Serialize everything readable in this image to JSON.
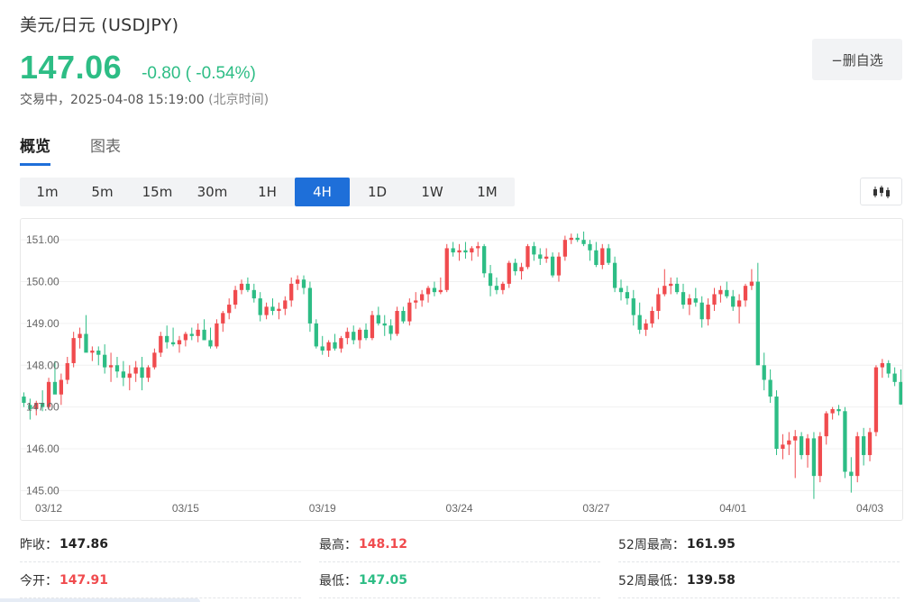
{
  "header": {
    "title": "美元/日元 (USDJPY)",
    "price": "147.06",
    "change": "-0.80 ( -0.54%)",
    "status": "交易中，2025-04-08 15:19:00",
    "timezone": "(北京时间)",
    "favorite_label": "−删自选"
  },
  "tabs": [
    {
      "label": "概览",
      "active": true
    },
    {
      "label": "图表",
      "active": false
    }
  ],
  "periods": [
    {
      "label": "1m"
    },
    {
      "label": "5m"
    },
    {
      "label": "15m"
    },
    {
      "label": "30m"
    },
    {
      "label": "1H"
    },
    {
      "label": "4H",
      "active": true
    },
    {
      "label": "1D"
    },
    {
      "label": "1W"
    },
    {
      "label": "1M"
    }
  ],
  "colors": {
    "up": "#f04b4e",
    "down": "#2dbd85",
    "accent": "#1e6fd9",
    "grid": "#f0f0f0"
  },
  "icons": {
    "chart_type": "candlestick-icon"
  },
  "chart_data": {
    "type": "candlestick",
    "interval": "4H",
    "ylim": [
      144.9,
      151.5
    ],
    "yticks": [
      "151.00",
      "150.00",
      "149.00",
      "148.00",
      "147.00",
      "146.00",
      "145.00"
    ],
    "xticks": [
      "03/12",
      "03/15",
      "03/19",
      "03/24",
      "03/27",
      "04/01",
      "04/03",
      "04/0"
    ],
    "candles": [
      [
        147.25,
        147.35,
        147.0,
        147.1
      ],
      [
        147.05,
        147.2,
        146.7,
        146.95
      ],
      [
        146.95,
        147.15,
        146.8,
        147.1
      ],
      [
        147.1,
        147.4,
        146.9,
        147.0
      ],
      [
        147.0,
        147.7,
        146.95,
        147.6
      ],
      [
        147.6,
        148.1,
        147.5,
        147.3
      ],
      [
        147.3,
        147.8,
        147.05,
        147.65
      ],
      [
        147.65,
        148.2,
        147.55,
        148.05
      ],
      [
        148.05,
        148.8,
        147.95,
        148.65
      ],
      [
        148.65,
        148.9,
        148.4,
        148.75
      ],
      [
        148.75,
        149.2,
        148.5,
        148.3
      ],
      [
        148.3,
        148.45,
        148.1,
        148.35
      ],
      [
        148.35,
        148.45,
        148.0,
        148.25
      ],
      [
        148.25,
        148.5,
        147.8,
        147.95
      ],
      [
        147.95,
        148.3,
        147.6,
        148.0
      ],
      [
        148.0,
        148.2,
        147.7,
        147.85
      ],
      [
        147.85,
        148.1,
        147.5,
        147.7
      ],
      [
        147.7,
        148.0,
        147.4,
        147.8
      ],
      [
        147.8,
        148.1,
        147.6,
        147.95
      ],
      [
        147.95,
        148.2,
        147.4,
        147.7
      ],
      [
        147.7,
        148.0,
        147.6,
        147.95
      ],
      [
        147.95,
        148.4,
        147.9,
        148.3
      ],
      [
        148.3,
        148.8,
        148.2,
        148.7
      ],
      [
        148.7,
        148.95,
        148.4,
        148.55
      ],
      [
        148.55,
        148.9,
        148.45,
        148.5
      ],
      [
        148.5,
        148.7,
        148.3,
        148.6
      ],
      [
        148.6,
        148.8,
        148.45,
        148.75
      ],
      [
        148.75,
        148.9,
        148.6,
        148.7
      ],
      [
        148.7,
        149.0,
        148.55,
        148.85
      ],
      [
        148.85,
        149.1,
        148.6,
        148.6
      ],
      [
        148.6,
        148.9,
        148.4,
        148.45
      ],
      [
        148.45,
        149.1,
        148.4,
        149.0
      ],
      [
        149.0,
        149.3,
        148.8,
        149.25
      ],
      [
        149.25,
        149.6,
        149.1,
        149.45
      ],
      [
        149.45,
        149.9,
        149.35,
        149.8
      ],
      [
        149.8,
        150.05,
        149.7,
        149.95
      ],
      [
        149.95,
        150.1,
        149.75,
        149.8
      ],
      [
        149.8,
        149.95,
        149.5,
        149.6
      ],
      [
        149.6,
        149.75,
        149.05,
        149.2
      ],
      [
        149.2,
        149.5,
        149.1,
        149.4
      ],
      [
        149.4,
        149.6,
        149.2,
        149.3
      ],
      [
        149.3,
        149.5,
        149.1,
        149.35
      ],
      [
        149.35,
        149.65,
        149.2,
        149.55
      ],
      [
        149.55,
        150.1,
        149.4,
        149.95
      ],
      [
        149.95,
        150.15,
        149.8,
        150.05
      ],
      [
        150.05,
        150.15,
        149.7,
        149.85
      ],
      [
        149.85,
        150.0,
        148.8,
        149.0
      ],
      [
        149.0,
        149.1,
        148.4,
        148.45
      ],
      [
        148.45,
        148.7,
        148.25,
        148.35
      ],
      [
        148.35,
        148.6,
        148.2,
        148.55
      ],
      [
        148.55,
        148.75,
        148.35,
        148.4
      ],
      [
        148.4,
        148.7,
        148.3,
        148.65
      ],
      [
        148.65,
        148.9,
        148.5,
        148.8
      ],
      [
        148.8,
        148.95,
        148.5,
        148.6
      ],
      [
        148.6,
        148.9,
        148.4,
        148.85
      ],
      [
        148.85,
        149.0,
        148.6,
        148.65
      ],
      [
        148.65,
        149.3,
        148.6,
        149.2
      ],
      [
        149.2,
        149.4,
        148.95,
        149.0
      ],
      [
        149.0,
        149.2,
        148.7,
        148.95
      ],
      [
        148.95,
        149.1,
        148.6,
        148.75
      ],
      [
        148.75,
        149.4,
        148.7,
        149.3
      ],
      [
        149.3,
        149.4,
        149.0,
        149.05
      ],
      [
        149.05,
        149.6,
        148.95,
        149.5
      ],
      [
        149.5,
        149.75,
        149.35,
        149.55
      ],
      [
        149.55,
        149.8,
        149.4,
        149.7
      ],
      [
        149.7,
        149.9,
        149.5,
        149.85
      ],
      [
        149.85,
        150.0,
        149.65,
        149.75
      ],
      [
        149.75,
        150.1,
        149.7,
        149.8
      ],
      [
        149.8,
        150.9,
        149.75,
        150.8
      ],
      [
        150.8,
        150.95,
        150.6,
        150.7
      ],
      [
        150.7,
        150.9,
        150.5,
        150.75
      ],
      [
        150.75,
        150.95,
        150.55,
        150.7
      ],
      [
        150.7,
        150.85,
        150.5,
        150.8
      ],
      [
        150.8,
        150.95,
        150.6,
        150.85
      ],
      [
        150.85,
        150.9,
        150.1,
        150.2
      ],
      [
        150.2,
        150.4,
        149.65,
        149.9
      ],
      [
        149.9,
        150.1,
        149.7,
        149.8
      ],
      [
        149.8,
        150.0,
        149.7,
        149.95
      ],
      [
        149.95,
        150.5,
        149.85,
        150.45
      ],
      [
        150.45,
        150.55,
        150.15,
        150.25
      ],
      [
        150.25,
        150.45,
        150.05,
        150.35
      ],
      [
        150.35,
        150.9,
        150.3,
        150.85
      ],
      [
        150.85,
        150.95,
        150.5,
        150.65
      ],
      [
        150.65,
        150.8,
        150.4,
        150.55
      ],
      [
        150.55,
        150.8,
        150.45,
        150.6
      ],
      [
        150.6,
        150.7,
        150.1,
        150.15
      ],
      [
        150.15,
        150.7,
        150.0,
        150.6
      ],
      [
        150.6,
        151.1,
        150.5,
        151.0
      ],
      [
        151.0,
        151.15,
        150.9,
        151.05
      ],
      [
        151.05,
        151.15,
        150.95,
        151.0
      ],
      [
        151.0,
        151.2,
        150.85,
        150.9
      ],
      [
        150.9,
        151.0,
        150.5,
        150.75
      ],
      [
        150.75,
        150.95,
        150.35,
        150.4
      ],
      [
        150.4,
        150.9,
        150.3,
        150.8
      ],
      [
        150.8,
        150.9,
        150.4,
        150.45
      ],
      [
        150.45,
        150.6,
        149.75,
        149.85
      ],
      [
        149.85,
        150.05,
        149.55,
        149.75
      ],
      [
        149.75,
        149.9,
        149.45,
        149.6
      ],
      [
        149.6,
        149.8,
        148.95,
        149.2
      ],
      [
        149.2,
        149.5,
        148.75,
        148.85
      ],
      [
        148.85,
        149.1,
        148.7,
        149.0
      ],
      [
        149.0,
        149.4,
        148.9,
        149.3
      ],
      [
        149.3,
        149.85,
        149.1,
        149.7
      ],
      [
        149.7,
        150.3,
        149.65,
        149.9
      ],
      [
        149.9,
        150.1,
        149.7,
        149.95
      ],
      [
        149.95,
        150.1,
        149.7,
        149.75
      ],
      [
        149.75,
        149.95,
        149.35,
        149.45
      ],
      [
        149.45,
        149.7,
        149.2,
        149.6
      ],
      [
        149.6,
        149.85,
        149.4,
        149.5
      ],
      [
        149.5,
        149.65,
        148.9,
        149.1
      ],
      [
        149.1,
        149.6,
        148.95,
        149.45
      ],
      [
        149.45,
        149.85,
        149.3,
        149.7
      ],
      [
        149.7,
        149.9,
        149.5,
        149.8
      ],
      [
        149.8,
        150.0,
        149.6,
        149.65
      ],
      [
        149.65,
        149.8,
        149.3,
        149.4
      ],
      [
        149.4,
        149.7,
        149.0,
        149.55
      ],
      [
        149.55,
        149.95,
        149.4,
        149.9
      ],
      [
        149.9,
        150.3,
        149.8,
        150.0
      ],
      [
        150.0,
        150.45,
        148.0,
        148.0
      ],
      [
        148.0,
        148.3,
        147.4,
        147.65
      ],
      [
        147.65,
        147.9,
        147.1,
        147.25
      ],
      [
        147.25,
        147.4,
        145.85,
        146.0
      ],
      [
        146.0,
        146.35,
        145.75,
        146.1
      ],
      [
        146.1,
        146.4,
        145.85,
        146.2
      ],
      [
        146.2,
        146.45,
        145.3,
        146.3
      ],
      [
        146.3,
        146.4,
        145.75,
        145.85
      ],
      [
        145.85,
        146.35,
        145.55,
        146.25
      ],
      [
        146.25,
        146.4,
        144.8,
        145.35
      ],
      [
        145.35,
        146.4,
        145.2,
        146.3
      ],
      [
        146.3,
        146.9,
        146.1,
        146.85
      ],
      [
        146.85,
        147.0,
        146.7,
        146.95
      ],
      [
        146.95,
        147.05,
        146.8,
        146.9
      ],
      [
        146.9,
        147.0,
        145.3,
        145.45
      ],
      [
        145.45,
        145.8,
        144.95,
        145.35
      ],
      [
        145.35,
        146.4,
        145.2,
        146.3
      ],
      [
        146.3,
        146.5,
        145.6,
        145.85
      ],
      [
        145.85,
        146.5,
        145.7,
        146.4
      ],
      [
        146.4,
        148.0,
        146.3,
        147.95
      ],
      [
        147.95,
        148.15,
        147.7,
        148.05
      ],
      [
        148.05,
        148.12,
        147.7,
        147.8
      ],
      [
        147.8,
        147.95,
        147.5,
        147.6
      ],
      [
        147.6,
        147.9,
        147.05,
        147.06
      ]
    ]
  },
  "stats": [
    [
      {
        "label": "昨收：",
        "value": "147.86",
        "tone": "black"
      },
      {
        "label": "最高：",
        "value": "148.12",
        "tone": "red"
      },
      {
        "label": "52周最高：",
        "value": "161.95",
        "tone": "black"
      }
    ],
    [
      {
        "label": "今开：",
        "value": "147.91",
        "tone": "red"
      },
      {
        "label": "最低：",
        "value": "147.05",
        "tone": "green"
      },
      {
        "label": "52周最低：",
        "value": "139.58",
        "tone": "black"
      }
    ]
  ]
}
